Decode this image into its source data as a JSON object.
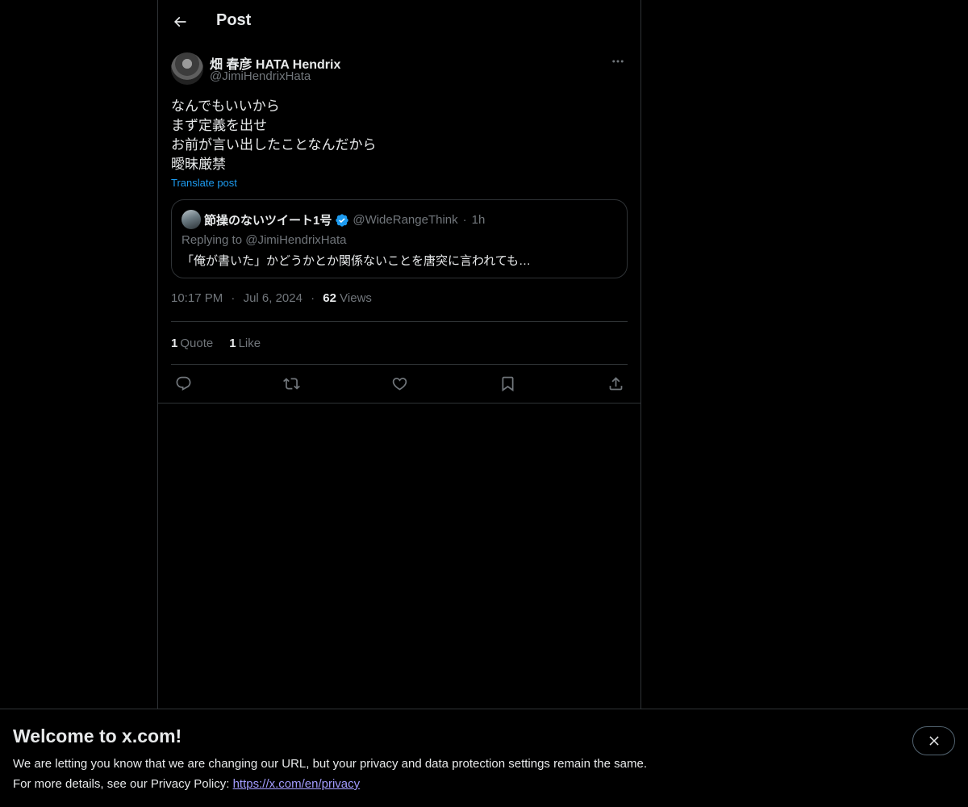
{
  "header": {
    "title": "Post"
  },
  "post": {
    "author": {
      "display_name": "畑 春彦 HATA Hendrix",
      "handle": "@JimiHendrixHata"
    },
    "text_lines": [
      "なんでもいいから",
      "まず定義を出せ",
      "お前が言い出したことなんだから",
      "曖昧厳禁"
    ],
    "translate_label": "Translate post",
    "quote": {
      "display_name": "節操のないツイート1号",
      "handle": "@WideRangeThink",
      "dot": "·",
      "time": "1h",
      "replying_to": "Replying to @JimiHendrixHata",
      "text": "「俺が書いた」かどうかとか関係ないことを唐突に言われても…"
    },
    "meta": {
      "time": "10:17 PM",
      "dot": "·",
      "date": "Jul 6, 2024",
      "views_count": "62",
      "views_label": "Views"
    },
    "stats": {
      "quotes_count": "1",
      "quotes_label": "Quote",
      "likes_count": "1",
      "likes_label": "Like"
    }
  },
  "banner": {
    "title": "Welcome to x.com!",
    "line1": "We are letting you know that we are changing our URL, but your privacy and data protection settings remain the same.",
    "line2_prefix": "For more details, see our Privacy Policy: ",
    "link": "https://x.com/en/privacy"
  },
  "colors": {
    "background": "#000000",
    "text_primary": "#e7e9ea",
    "text_secondary": "#71767b",
    "accent": "#1d9bf0",
    "border": "#2f3336"
  },
  "icons": {
    "back": "arrow-left-icon",
    "more": "more-dots-icon",
    "verified": "verified-badge-icon",
    "reply": "reply-icon",
    "repost": "repost-icon",
    "like": "heart-icon",
    "bookmark": "bookmark-icon",
    "share": "share-icon",
    "close": "close-icon"
  }
}
